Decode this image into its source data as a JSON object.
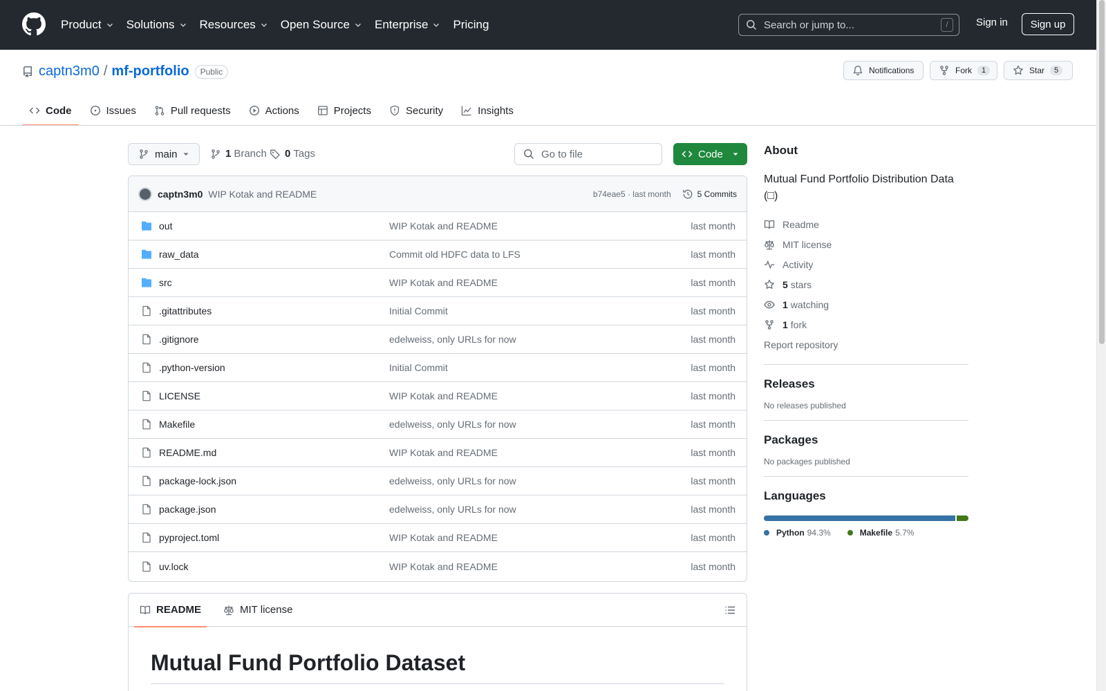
{
  "header": {
    "nav": [
      {
        "label": "Product",
        "dropdown": true
      },
      {
        "label": "Solutions",
        "dropdown": true
      },
      {
        "label": "Resources",
        "dropdown": true
      },
      {
        "label": "Open Source",
        "dropdown": true
      },
      {
        "label": "Enterprise",
        "dropdown": true
      },
      {
        "label": "Pricing",
        "dropdown": false
      }
    ],
    "search_placeholder": "Search or jump to...",
    "search_shortcut": "/",
    "sign_in": "Sign in",
    "sign_up": "Sign up"
  },
  "repo": {
    "owner": "captn3m0",
    "separator": "/",
    "name": "mf-portfolio",
    "visibility": "Public",
    "notifications_label": "Notifications",
    "fork_label": "Fork",
    "fork_count": "1",
    "star_label": "Star",
    "star_count": "5"
  },
  "tabs": [
    {
      "label": "Code",
      "icon": "code-icon",
      "active": true
    },
    {
      "label": "Issues",
      "icon": "issue-icon",
      "active": false
    },
    {
      "label": "Pull requests",
      "icon": "pull-request-icon",
      "active": false
    },
    {
      "label": "Actions",
      "icon": "play-icon",
      "active": false
    },
    {
      "label": "Projects",
      "icon": "table-icon",
      "active": false
    },
    {
      "label": "Security",
      "icon": "shield-icon",
      "active": false
    },
    {
      "label": "Insights",
      "icon": "graph-icon",
      "active": false
    }
  ],
  "filenav": {
    "branch": "main",
    "branches_count": "1",
    "branches_label": "Branch",
    "tags_count": "0",
    "tags_label": "Tags",
    "goto_placeholder": "Go to file",
    "code_button": "Code"
  },
  "commit": {
    "author": "captn3m0",
    "message": "WIP Kotak and README",
    "hash_time": "b74eae5 · last month",
    "commits_label": "5 Commits"
  },
  "files": [
    {
      "name": "out",
      "type": "dir",
      "commit": "WIP Kotak and README",
      "age": "last month"
    },
    {
      "name": "raw_data",
      "type": "dir",
      "commit": "Commit old HDFC data to LFS",
      "age": "last month"
    },
    {
      "name": "src",
      "type": "dir",
      "commit": "WIP Kotak and README",
      "age": "last month"
    },
    {
      "name": ".gitattributes",
      "type": "file",
      "commit": "Initial Commit",
      "age": "last month"
    },
    {
      "name": ".gitignore",
      "type": "file",
      "commit": "edelweiss, only URLs for now",
      "age": "last month"
    },
    {
      "name": ".python-version",
      "type": "file",
      "commit": "Initial Commit",
      "age": "last month"
    },
    {
      "name": "LICENSE",
      "type": "file",
      "commit": "WIP Kotak and README",
      "age": "last month"
    },
    {
      "name": "Makefile",
      "type": "file",
      "commit": "edelweiss, only URLs for now",
      "age": "last month"
    },
    {
      "name": "README.md",
      "type": "file",
      "commit": "WIP Kotak and README",
      "age": "last month"
    },
    {
      "name": "package-lock.json",
      "type": "file",
      "commit": "edelweiss, only URLs for now",
      "age": "last month"
    },
    {
      "name": "package.json",
      "type": "file",
      "commit": "edelweiss, only URLs for now",
      "age": "last month"
    },
    {
      "name": "pyproject.toml",
      "type": "file",
      "commit": "WIP Kotak and README",
      "age": "last month"
    },
    {
      "name": "uv.lock",
      "type": "file",
      "commit": "WIP Kotak and README",
      "age": "last month"
    }
  ],
  "readme": {
    "tab_readme": "README",
    "tab_license": "MIT license",
    "heading": "Mutual Fund Portfolio Dataset"
  },
  "about": {
    "title": "About",
    "description": "Mutual Fund Portfolio Distribution Data (□)",
    "readme": "Readme",
    "license": "MIT license",
    "activity": "Activity",
    "stars_count": "5",
    "stars_label": "stars",
    "watching_count": "1",
    "watching_label": "watching",
    "forks_count": "1",
    "forks_label": "fork",
    "report": "Report repository"
  },
  "releases": {
    "title": "Releases",
    "empty": "No releases published"
  },
  "packages": {
    "title": "Packages",
    "empty": "No packages published"
  },
  "languages": {
    "title": "Languages",
    "items": [
      {
        "name": "Python",
        "percent": "94.3%",
        "value": 94.3,
        "color": "#3572A5"
      },
      {
        "name": "Makefile",
        "percent": "5.7%",
        "value": 5.7,
        "color": "#427819"
      }
    ]
  },
  "colors": {
    "link": "#0969da",
    "code_button": "#1f883d",
    "active_tab_underline": "#fd8c73",
    "folder": "#54aeff"
  }
}
